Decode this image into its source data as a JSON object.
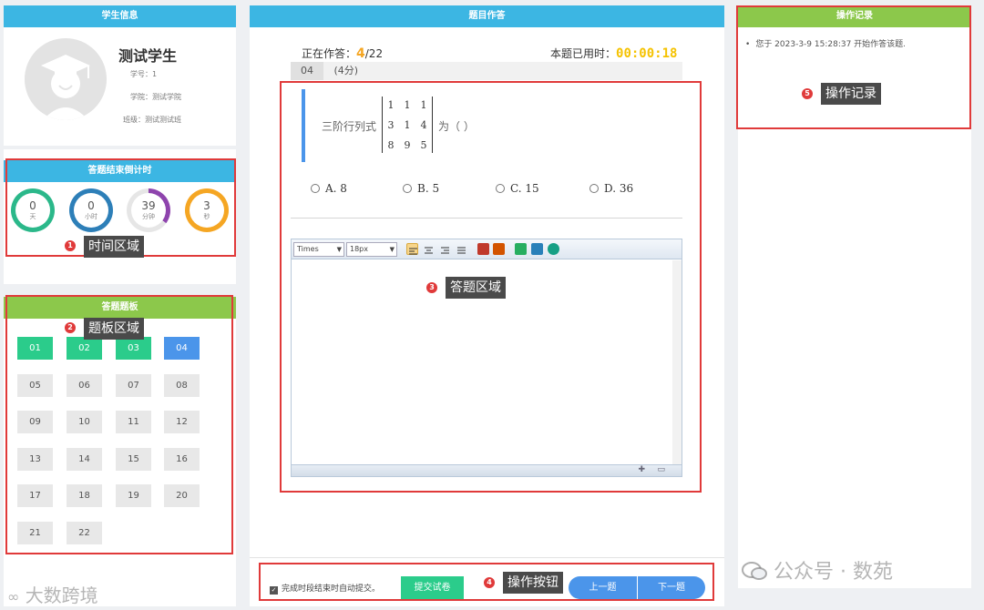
{
  "student_info": {
    "title": "学生信息",
    "name": "测试学生",
    "id_label": "学号：1",
    "college": "学院：测试学院",
    "class": "班级：测试测试班"
  },
  "timer": {
    "title": "答题结束倒计时",
    "units": [
      {
        "value": "0",
        "unit": "天",
        "color": "#2bb88a",
        "fraction": 1.0
      },
      {
        "value": "0",
        "unit": "小时",
        "color": "#2d7fb8",
        "fraction": 1.0
      },
      {
        "value": "39",
        "unit": "分钟",
        "color": "#8e44ad",
        "fraction": 0.35
      },
      {
        "value": "3",
        "unit": "秒",
        "color": "#f5a623",
        "fraction": 1.0
      }
    ]
  },
  "board": {
    "title": "答题题板",
    "questions": [
      "01",
      "02",
      "03",
      "04",
      "05",
      "06",
      "07",
      "08",
      "09",
      "10",
      "11",
      "12",
      "13",
      "14",
      "15",
      "16",
      "17",
      "18",
      "19",
      "20",
      "21",
      "22"
    ],
    "done": [
      "01",
      "02",
      "03"
    ],
    "current": "04"
  },
  "main": {
    "title": "题目作答",
    "answering_label": "正在作答：",
    "answering_current": "4",
    "answering_total": "/22",
    "elapsed_label": "本题已用时：",
    "elapsed_value": "00:00:18",
    "question_no": "04",
    "question_score": "(4分)",
    "stem_prefix": "三阶行列式",
    "stem_suffix": "为（    ）",
    "matrix": [
      [
        "1",
        "1",
        "1"
      ],
      [
        "3",
        "1",
        "4"
      ],
      [
        "8",
        "9",
        "5"
      ]
    ],
    "options": [
      "A. 8",
      "B. 5",
      "C. 15",
      "D. 36"
    ],
    "editor": {
      "font": "Times",
      "size": "18px"
    },
    "auto_submit_label": "完成时段结束时自动提交。",
    "submit_label": "提交试卷",
    "prev_label": "上一题",
    "next_label": "下一题"
  },
  "log": {
    "title": "操作记录",
    "entries": [
      "您于 2023-3-9  15:28:37 开始作答该题."
    ]
  },
  "annotations": {
    "time_area": "时间区域",
    "board_area": "题板区域",
    "answer_area": "答题区域",
    "buttons_area": "操作按钮",
    "log_area": "操作记录"
  },
  "watermarks": {
    "left": "大数跨境",
    "right": "公众号 · 数苑"
  },
  "colors": {
    "header_blue": "#3cb6e3",
    "header_green": "#8cc84b",
    "done": "#2bcc8b",
    "current": "#4b95ea",
    "highlight": "#f5a623",
    "annotation_red": "#e03a3a"
  }
}
